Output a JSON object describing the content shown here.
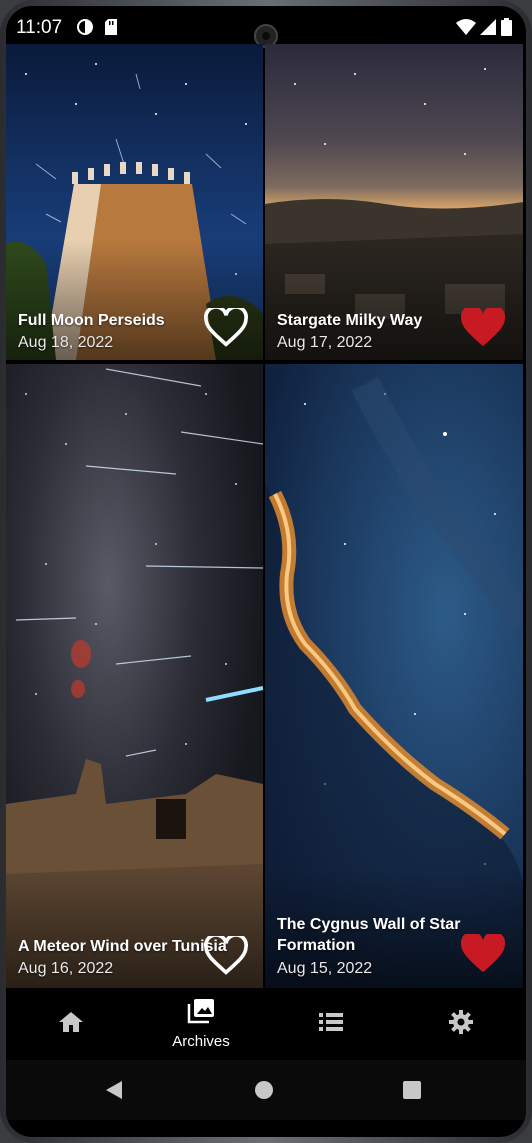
{
  "status": {
    "time": "11:07"
  },
  "cards": [
    {
      "title": "Full Moon Perseids",
      "date": "Aug 18, 2022",
      "favorite": false
    },
    {
      "title": "Stargate Milky Way",
      "date": "Aug 17, 2022",
      "favorite": true
    },
    {
      "title": "A Meteor Wind over Tunisia",
      "date": "Aug 16, 2022",
      "favorite": false
    },
    {
      "title": "The Cygnus Wall of Star Formation",
      "date": "Aug 15, 2022",
      "favorite": true
    }
  ],
  "nav": {
    "items": [
      {
        "icon": "home-icon",
        "label": ""
      },
      {
        "icon": "archives-icon",
        "label": "Archives",
        "active": true
      },
      {
        "icon": "list-icon",
        "label": ""
      },
      {
        "icon": "settings-icon",
        "label": ""
      }
    ]
  },
  "colors": {
    "favorite": "#c81a22",
    "background": "#000000"
  }
}
